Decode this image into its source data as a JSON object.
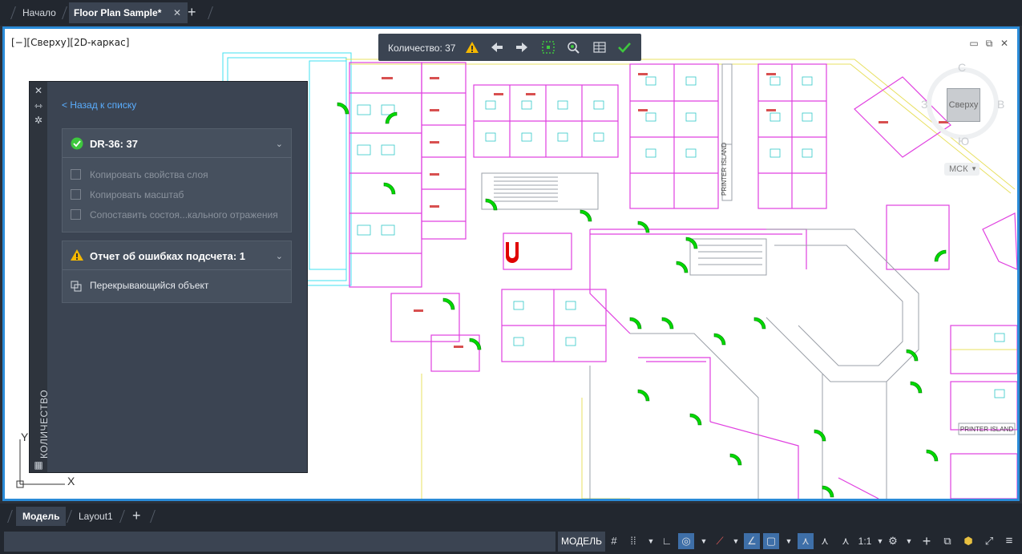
{
  "tabs": {
    "home": "Начало",
    "file": "Floor Plan Sample*",
    "close": "✕",
    "add": "+"
  },
  "viewport": {
    "label": "[−][Сверху][2D-каркас]",
    "window_controls": [
      "▭",
      "⧉",
      "✕"
    ]
  },
  "quantity_toolbar": {
    "label": "Количество:  37",
    "icons": [
      "warning-icon",
      "arrow-left-icon",
      "arrow-right-icon",
      "select-icon",
      "zoom-object-icon",
      "table-icon",
      "checkmark-icon"
    ]
  },
  "viewcube": {
    "top": "Сверху",
    "north": "С",
    "south": "Ю",
    "east": "В",
    "west": "З",
    "ucs": "МСК"
  },
  "ucs_icon": {
    "x": "X",
    "y": "Y"
  },
  "panel": {
    "vertical_title": "КОЛИЧЕСТВО",
    "back_link": "< Назад к списку",
    "block_card": {
      "title": "DR-36: 37",
      "options": [
        "Копировать свойства слоя",
        "Копировать масштаб",
        "Сопоставить состоя...кального отражения"
      ]
    },
    "error_card": {
      "title": "Отчет об ошибках подсчета: 1",
      "item": "Перекрывающийся объект"
    }
  },
  "drawing_labels": {
    "printer_island_1": "PRINTER ISLAND",
    "printer_island_2": "PRINTER ISLAND"
  },
  "layout_tabs": {
    "model": "Модель",
    "layout1": "Layout1",
    "add": "+"
  },
  "status_bar": {
    "model": "МОДЕЛЬ",
    "scale": "1:1",
    "icons": [
      "grid-icon",
      "snap-icon",
      "ortho-icon",
      "polar-icon",
      "osnap-icon",
      "lineweight-icon",
      "annotation-visibility-icon",
      "annotation-scale-icon",
      "workspace-gear-icon",
      "plus-icon",
      "isolate-icon",
      "units-icon",
      "fullscreen-icon",
      "menu-icon"
    ]
  },
  "colors": {
    "accent": "#2a8bd8",
    "door_green": "#00d800",
    "wall_magenta": "#e040e0",
    "wall_cyan": "#40e0f0",
    "wall_yellow": "#e8e060"
  }
}
